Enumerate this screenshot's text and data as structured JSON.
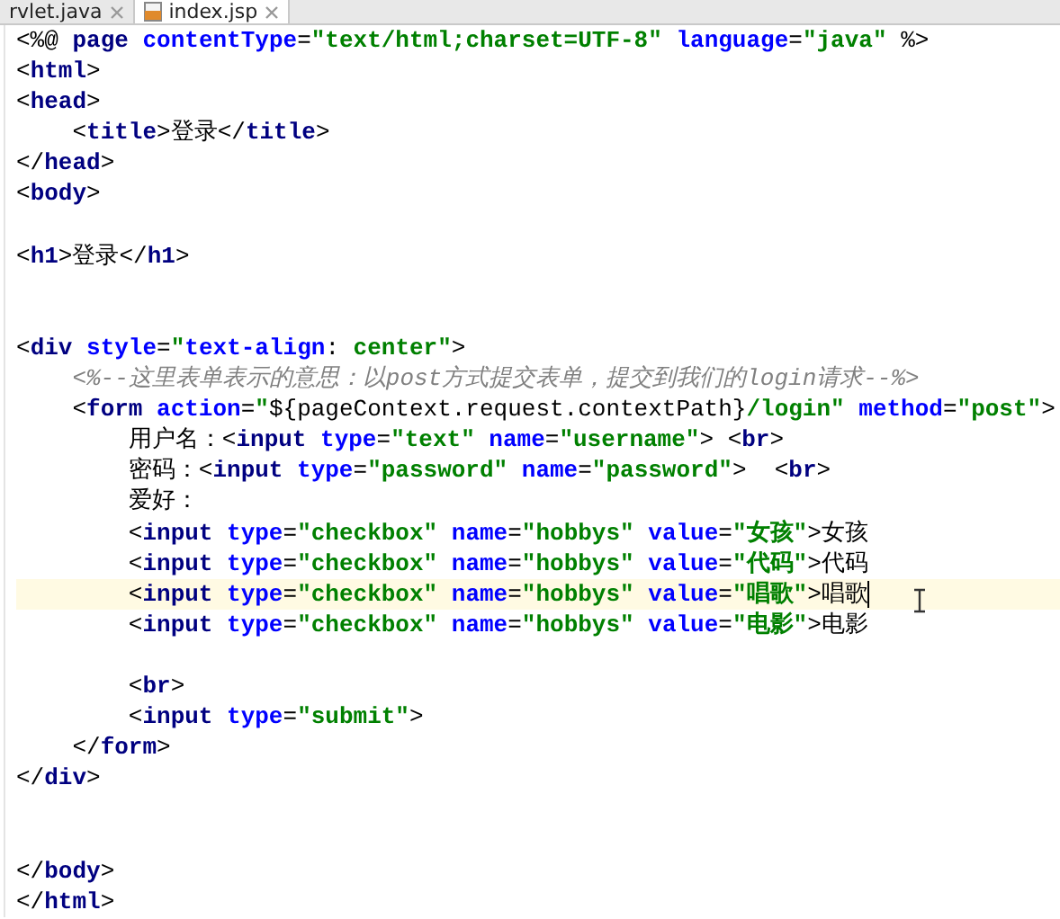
{
  "tabs": [
    {
      "label": "rvlet.java",
      "selected": false,
      "kind": "java"
    },
    {
      "label": "index.jsp",
      "selected": true,
      "kind": "jsp"
    }
  ],
  "lines": [
    {
      "current": false,
      "tokens": [
        {
          "kind": "tag",
          "text": "<%@ "
        },
        {
          "kind": "tagname",
          "text": "page "
        },
        {
          "kind": "attr",
          "text": "contentType"
        },
        {
          "kind": "plain",
          "text": "="
        },
        {
          "kind": "str",
          "text": "\"text/html;charset=UTF-8\" "
        },
        {
          "kind": "attr",
          "text": "language"
        },
        {
          "kind": "plain",
          "text": "="
        },
        {
          "kind": "str",
          "text": "\"java\" "
        },
        {
          "kind": "tag",
          "text": "%>"
        }
      ]
    },
    {
      "current": false,
      "tokens": [
        {
          "kind": "tag",
          "text": "<"
        },
        {
          "kind": "tagname",
          "text": "html"
        },
        {
          "kind": "tag",
          "text": ">"
        }
      ]
    },
    {
      "current": false,
      "tokens": [
        {
          "kind": "tag",
          "text": "<"
        },
        {
          "kind": "tagname",
          "text": "head"
        },
        {
          "kind": "tag",
          "text": ">"
        }
      ],
      "children": [
        {
          "current": false,
          "tokens": [
            {
              "kind": "tag",
              "text": "<"
            },
            {
              "kind": "tagname",
              "text": "title"
            },
            {
              "kind": "tag",
              "text": ">"
            },
            {
              "kind": "plain",
              "text": "登录"
            },
            {
              "kind": "tag",
              "text": "</"
            },
            {
              "kind": "tagname",
              "text": "title"
            },
            {
              "kind": "tag",
              "text": ">"
            }
          ]
        }
      ]
    },
    {
      "current": false,
      "tokens": [
        {
          "kind": "tag",
          "text": "</"
        },
        {
          "kind": "tagname",
          "text": "head"
        },
        {
          "kind": "tag",
          "text": ">"
        }
      ]
    },
    {
      "current": false,
      "tokens": [
        {
          "kind": "tag",
          "text": "<"
        },
        {
          "kind": "tagname",
          "text": "body"
        },
        {
          "kind": "tag",
          "text": ">"
        }
      ]
    },
    {
      "current": false
    },
    {
      "current": false,
      "tokens": [
        {
          "kind": "tag",
          "text": "<"
        },
        {
          "kind": "tagname",
          "text": "h1"
        },
        {
          "kind": "tag",
          "text": ">"
        },
        {
          "kind": "plain",
          "text": "登录"
        },
        {
          "kind": "tag",
          "text": "</"
        },
        {
          "kind": "tagname",
          "text": "h1"
        },
        {
          "kind": "tag",
          "text": ">"
        }
      ]
    },
    {
      "current": false
    },
    {
      "current": false
    },
    {
      "current": false,
      "tokens": [
        {
          "kind": "tag",
          "text": "<"
        },
        {
          "kind": "tagname",
          "text": "div "
        },
        {
          "kind": "attr",
          "text": "style"
        },
        {
          "kind": "plain",
          "text": "="
        },
        {
          "kind": "str",
          "text": "\""
        },
        {
          "kind": "attr",
          "text": "text-align"
        },
        {
          "kind": "plain",
          "text": ": "
        },
        {
          "kind": "str",
          "text": "center\""
        },
        {
          "kind": "tag",
          "text": ">"
        }
      ],
      "children": [
        {
          "current": false,
          "tokens": [
            {
              "kind": "comment",
              "text": "<%--这里表单表示的意思：以post方式提交表单，提交到我们的login请求--%>"
            }
          ]
        },
        {
          "current": false,
          "tokens": [
            {
              "kind": "tag",
              "text": "<"
            },
            {
              "kind": "tagname",
              "text": "form "
            },
            {
              "kind": "attr",
              "text": "action"
            },
            {
              "kind": "plain",
              "text": "="
            },
            {
              "kind": "str",
              "text": "\""
            },
            {
              "kind": "plain",
              "text": "${pageContext.request.contextPath}"
            },
            {
              "kind": "str",
              "text": "/login\" "
            },
            {
              "kind": "attr",
              "text": "method"
            },
            {
              "kind": "plain",
              "text": "="
            },
            {
              "kind": "str",
              "text": "\"post\""
            },
            {
              "kind": "tag",
              "text": ">"
            }
          ],
          "children": [
            {
              "current": false,
              "tokens": [
                {
                  "kind": "plain",
                  "text": "用户名："
                },
                {
                  "kind": "tag",
                  "text": "<"
                },
                {
                  "kind": "tagname",
                  "text": "input "
                },
                {
                  "kind": "attr",
                  "text": "type"
                },
                {
                  "kind": "plain",
                  "text": "="
                },
                {
                  "kind": "str",
                  "text": "\"text\" "
                },
                {
                  "kind": "attr",
                  "text": "name"
                },
                {
                  "kind": "plain",
                  "text": "="
                },
                {
                  "kind": "str",
                  "text": "\"username\""
                },
                {
                  "kind": "tag",
                  "text": "> <"
                },
                {
                  "kind": "tagname",
                  "text": "br"
                },
                {
                  "kind": "tag",
                  "text": ">"
                }
              ]
            },
            {
              "current": false,
              "tokens": [
                {
                  "kind": "plain",
                  "text": "密码："
                },
                {
                  "kind": "tag",
                  "text": "<"
                },
                {
                  "kind": "tagname",
                  "text": "input "
                },
                {
                  "kind": "attr",
                  "text": "type"
                },
                {
                  "kind": "plain",
                  "text": "="
                },
                {
                  "kind": "str",
                  "text": "\"password\" "
                },
                {
                  "kind": "attr",
                  "text": "name"
                },
                {
                  "kind": "plain",
                  "text": "="
                },
                {
                  "kind": "str",
                  "text": "\"password\""
                },
                {
                  "kind": "tag",
                  "text": ">  <"
                },
                {
                  "kind": "tagname",
                  "text": "br"
                },
                {
                  "kind": "tag",
                  "text": ">"
                }
              ]
            },
            {
              "current": false,
              "tokens": [
                {
                  "kind": "plain",
                  "text": "爱好："
                }
              ]
            },
            {
              "current": false,
              "tokens": [
                {
                  "kind": "tag",
                  "text": "<"
                },
                {
                  "kind": "tagname",
                  "text": "input "
                },
                {
                  "kind": "attr",
                  "text": "type"
                },
                {
                  "kind": "plain",
                  "text": "="
                },
                {
                  "kind": "str",
                  "text": "\"checkbox\" "
                },
                {
                  "kind": "attr",
                  "text": "name"
                },
                {
                  "kind": "plain",
                  "text": "="
                },
                {
                  "kind": "str",
                  "text": "\"hobbys\" "
                },
                {
                  "kind": "attr",
                  "text": "value"
                },
                {
                  "kind": "plain",
                  "text": "="
                },
                {
                  "kind": "str",
                  "text": "\"女孩\""
                },
                {
                  "kind": "tag",
                  "text": ">"
                },
                {
                  "kind": "plain",
                  "text": "女孩"
                }
              ]
            },
            {
              "current": false,
              "tokens": [
                {
                  "kind": "tag",
                  "text": "<"
                },
                {
                  "kind": "tagname",
                  "text": "input "
                },
                {
                  "kind": "attr",
                  "text": "type"
                },
                {
                  "kind": "plain",
                  "text": "="
                },
                {
                  "kind": "str",
                  "text": "\"checkbox\" "
                },
                {
                  "kind": "attr",
                  "text": "name"
                },
                {
                  "kind": "plain",
                  "text": "="
                },
                {
                  "kind": "str",
                  "text": "\"hobbys\" "
                },
                {
                  "kind": "attr",
                  "text": "value"
                },
                {
                  "kind": "plain",
                  "text": "="
                },
                {
                  "kind": "str",
                  "text": "\"代码\""
                },
                {
                  "kind": "tag",
                  "text": ">"
                },
                {
                  "kind": "plain",
                  "text": "代码"
                }
              ]
            },
            {
              "current": true,
              "tokens": [
                {
                  "kind": "tag",
                  "text": "<"
                },
                {
                  "kind": "tagname",
                  "text": "input "
                },
                {
                  "kind": "attr",
                  "text": "type"
                },
                {
                  "kind": "plain",
                  "text": "="
                },
                {
                  "kind": "str",
                  "text": "\"checkbox\" "
                },
                {
                  "kind": "attr",
                  "text": "name"
                },
                {
                  "kind": "plain",
                  "text": "="
                },
                {
                  "kind": "str",
                  "text": "\"hobbys\" "
                },
                {
                  "kind": "attr",
                  "text": "value"
                },
                {
                  "kind": "plain",
                  "text": "="
                },
                {
                  "kind": "str",
                  "text": "\"唱歌\""
                },
                {
                  "kind": "tag",
                  "text": ">"
                },
                {
                  "kind": "plain",
                  "text": "唱歌"
                }
              ]
            },
            {
              "current": false,
              "tokens": [
                {
                  "kind": "tag",
                  "text": "<"
                },
                {
                  "kind": "tagname",
                  "text": "input "
                },
                {
                  "kind": "attr",
                  "text": "type"
                },
                {
                  "kind": "plain",
                  "text": "="
                },
                {
                  "kind": "str",
                  "text": "\"checkbox\" "
                },
                {
                  "kind": "attr",
                  "text": "name"
                },
                {
                  "kind": "plain",
                  "text": "="
                },
                {
                  "kind": "str",
                  "text": "\"hobbys\" "
                },
                {
                  "kind": "attr",
                  "text": "value"
                },
                {
                  "kind": "plain",
                  "text": "="
                },
                {
                  "kind": "str",
                  "text": "\"电影\""
                },
                {
                  "kind": "tag",
                  "text": ">"
                },
                {
                  "kind": "plain",
                  "text": "电影"
                }
              ]
            },
            {
              "current": false
            },
            {
              "current": false,
              "tokens": [
                {
                  "kind": "tag",
                  "text": "<"
                },
                {
                  "kind": "tagname",
                  "text": "br"
                },
                {
                  "kind": "tag",
                  "text": ">"
                }
              ]
            },
            {
              "current": false,
              "tokens": [
                {
                  "kind": "tag",
                  "text": "<"
                },
                {
                  "kind": "tagname",
                  "text": "input "
                },
                {
                  "kind": "attr",
                  "text": "type"
                },
                {
                  "kind": "plain",
                  "text": "="
                },
                {
                  "kind": "str",
                  "text": "\"submit\""
                },
                {
                  "kind": "tag",
                  "text": ">"
                }
              ]
            }
          ]
        },
        {
          "current": false,
          "tokens": [
            {
              "kind": "tag",
              "text": "</"
            },
            {
              "kind": "tagname",
              "text": "form"
            },
            {
              "kind": "tag",
              "text": ">"
            }
          ]
        }
      ]
    },
    {
      "current": false,
      "tokens": [
        {
          "kind": "tag",
          "text": "</"
        },
        {
          "kind": "tagname",
          "text": "div"
        },
        {
          "kind": "tag",
          "text": ">"
        }
      ]
    },
    {
      "current": false
    },
    {
      "current": false
    },
    {
      "current": false,
      "tokens": [
        {
          "kind": "tag",
          "text": "</"
        },
        {
          "kind": "tagname",
          "text": "body"
        },
        {
          "kind": "tag",
          "text": ">"
        }
      ]
    },
    {
      "current": false,
      "tokens": [
        {
          "kind": "tag",
          "text": "</"
        },
        {
          "kind": "tagname",
          "text": "html"
        },
        {
          "kind": "tag",
          "text": ">"
        }
      ]
    }
  ]
}
